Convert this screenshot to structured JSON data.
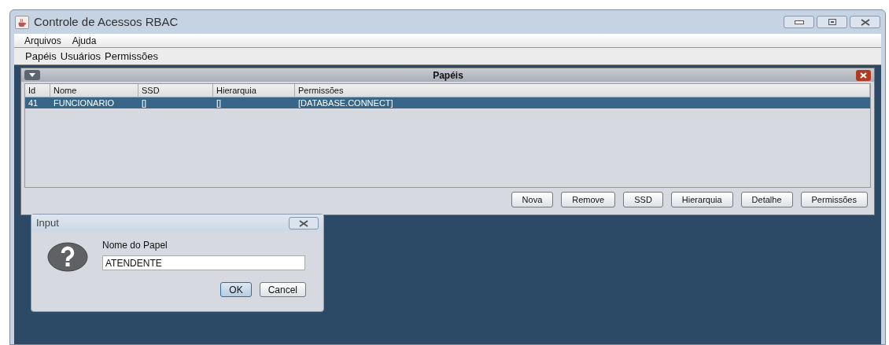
{
  "window": {
    "title": "Controle de Acessos RBAC"
  },
  "menu": [
    "Arquivos",
    "Ajuda"
  ],
  "toolbar": [
    "Papéis",
    "Usuários",
    "Permissões"
  ],
  "frame": {
    "title": "Papéis",
    "table": {
      "columns": [
        "Id",
        "Nome",
        "SSD",
        "Hierarquia",
        "Permissões"
      ],
      "rows": [
        {
          "cells": [
            "41",
            "FUNCIONARIO",
            "[]",
            "[]",
            "[DATABASE.CONNECT]"
          ],
          "selected": true
        }
      ]
    },
    "buttons": [
      "Nova",
      "Remove",
      "SSD",
      "Hierarquia",
      "Detalhe",
      "Permissões"
    ]
  },
  "dialog": {
    "title": "Input",
    "label": "Nome do Papel",
    "value": "ATENDENTE",
    "buttons": [
      {
        "label": "OK",
        "default": true
      },
      {
        "label": "Cancel",
        "default": false
      }
    ]
  }
}
